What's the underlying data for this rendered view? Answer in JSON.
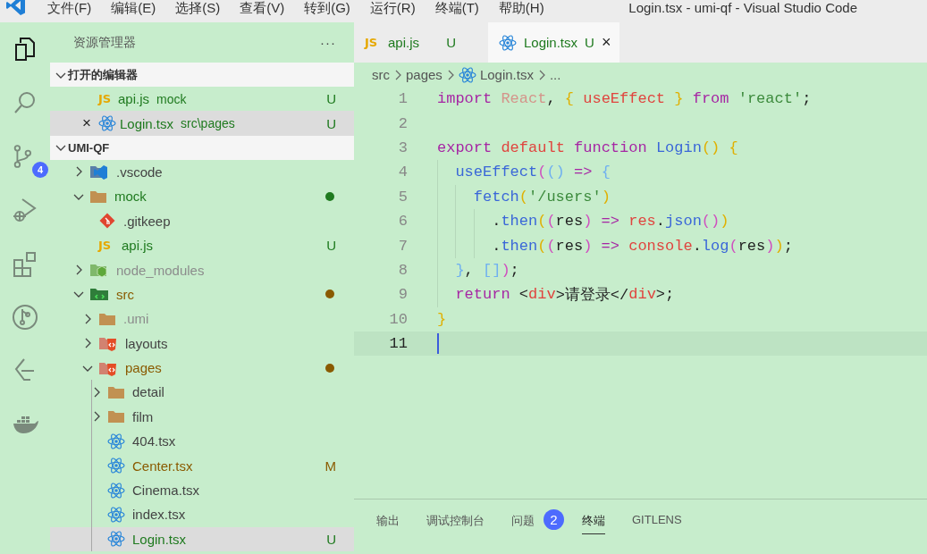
{
  "window": {
    "title": "Login.tsx - umi-qf - Visual Studio Code"
  },
  "menu": [
    {
      "label": "文件(F)"
    },
    {
      "label": "编辑(E)"
    },
    {
      "label": "选择(S)"
    },
    {
      "label": "查看(V)"
    },
    {
      "label": "转到(G)"
    },
    {
      "label": "运行(R)"
    },
    {
      "label": "终端(T)"
    },
    {
      "label": "帮助(H)"
    }
  ],
  "activity_bar": [
    {
      "kind": "explorer",
      "selected": true
    },
    {
      "kind": "search",
      "selected": false
    },
    {
      "kind": "scm",
      "selected": false,
      "badge": "4"
    },
    {
      "kind": "debug",
      "selected": false
    },
    {
      "kind": "extensions",
      "selected": false
    },
    {
      "kind": "git-graph",
      "selected": false
    },
    {
      "kind": "leetcode",
      "selected": false
    },
    {
      "kind": "docker",
      "selected": false
    }
  ],
  "sidebar": {
    "title": "资源管理器",
    "more": "···",
    "open_editors": {
      "title": "打开的编辑器",
      "expanded": true,
      "items": [
        {
          "name": "api.js",
          "description": "mock",
          "kind": "js",
          "icon_label": "JS",
          "status": "U",
          "color": "#1f7a1f",
          "selected": false
        },
        {
          "name": "Login.tsx",
          "description": "src\\pages",
          "kind": "react",
          "status": "U",
          "color": "#1f7a1f",
          "selected": true,
          "close": "×"
        }
      ]
    },
    "workspace": {
      "title": "UMI-QF",
      "expanded": true,
      "tree": [
        {
          "name": ".vscode",
          "kind": "vscode-folder",
          "expanded": false,
          "color": "#444444",
          "selected": false
        },
        {
          "name": "mock",
          "kind": "folder",
          "expanded": true,
          "color": "#1f7a1f",
          "changes": true,
          "selected": false,
          "children": [
            {
              "name": ".gitkeep",
              "kind": "git-file",
              "color": "#444444",
              "selected": false
            },
            {
              "name": "api.js",
              "kind": "js",
              "icon_label": "JS",
              "color": "#1f7a1f",
              "status": "U",
              "selected": false
            }
          ]
        },
        {
          "name": "node_modules",
          "kind": "node-folder",
          "expanded": false,
          "color": "#8c8c8c",
          "selected": false
        },
        {
          "name": "src",
          "kind": "src-folder",
          "expanded": true,
          "color": "#8a5a00",
          "changes": true,
          "selected": false,
          "children": [
            {
              "name": ".umi",
              "kind": "folder",
              "expanded": false,
              "color": "#8c8c8c",
              "selected": false
            },
            {
              "name": "layouts",
              "kind": "html-folder",
              "expanded": false,
              "color": "#444444",
              "selected": false
            },
            {
              "name": "pages",
              "kind": "html-folder",
              "expanded": true,
              "color": "#8a5a00",
              "changes": true,
              "selected": false,
              "children": [
                {
                  "name": "detail",
                  "kind": "folder",
                  "expanded": false,
                  "color": "#444444",
                  "selected": false
                },
                {
                  "name": "film",
                  "kind": "folder",
                  "expanded": false,
                  "color": "#444444",
                  "selected": false
                },
                {
                  "name": "404.tsx",
                  "kind": "react",
                  "color": "#444444",
                  "selected": false
                },
                {
                  "name": "Center.tsx",
                  "kind": "react",
                  "color": "#8a5a00",
                  "status": "M",
                  "selected": false
                },
                {
                  "name": "Cinema.tsx",
                  "kind": "react",
                  "color": "#444444",
                  "selected": false
                },
                {
                  "name": "index.tsx",
                  "kind": "react",
                  "color": "#444444",
                  "selected": false
                },
                {
                  "name": "Login.tsx",
                  "kind": "react",
                  "color": "#1f7a1f",
                  "status": "U",
                  "selected": true
                }
              ]
            }
          ]
        }
      ]
    }
  },
  "editor": {
    "tabs": [
      {
        "label": "api.js",
        "kind": "js",
        "icon_label": "JS",
        "status": "U",
        "selected": false
      },
      {
        "label": "Login.tsx",
        "kind": "react",
        "status": "U",
        "selected": true,
        "close": "×"
      }
    ],
    "breadcrumbs": [
      {
        "label": "src"
      },
      {
        "label": "pages"
      },
      {
        "label": "Login.tsx",
        "kind": "react"
      },
      {
        "label": "..."
      }
    ],
    "lines": [
      {
        "number": "1",
        "current": false,
        "tokens": [
          {
            "kind": "kw",
            "text": "import "
          },
          {
            "kind": "muted",
            "text": "React"
          },
          {
            "kind": "plain",
            "text": ", "
          },
          {
            "kind": "b1",
            "text": "{ "
          },
          {
            "kind": "red",
            "text": "useEffect "
          },
          {
            "kind": "b1",
            "text": "} "
          },
          {
            "kind": "kw",
            "text": "from "
          },
          {
            "kind": "str",
            "text": "'react'"
          },
          {
            "kind": "plain",
            "text": ";"
          }
        ]
      },
      {
        "number": "2",
        "current": false
      },
      {
        "number": "3",
        "current": false,
        "tokens": [
          {
            "kind": "kw",
            "text": "export "
          },
          {
            "kind": "red",
            "text": "default "
          },
          {
            "kind": "kw",
            "text": "function "
          },
          {
            "kind": "fn",
            "text": "Login"
          },
          {
            "kind": "b1",
            "text": "() {"
          }
        ]
      },
      {
        "number": "4",
        "current": false,
        "tokens": [
          {
            "kind": "fn",
            "text": "  useEffect"
          },
          {
            "kind": "b2",
            "text": "("
          },
          {
            "kind": "b3",
            "text": "() "
          },
          {
            "kind": "kw",
            "text": "=> "
          },
          {
            "kind": "b3",
            "text": "{"
          }
        ]
      },
      {
        "number": "5",
        "current": false,
        "tokens": [
          {
            "kind": "fn",
            "text": "    fetch"
          },
          {
            "kind": "b1",
            "text": "("
          },
          {
            "kind": "str",
            "text": "'/users'"
          },
          {
            "kind": "b1",
            "text": ")"
          }
        ]
      },
      {
        "number": "6",
        "current": false,
        "tokens": [
          {
            "kind": "plain",
            "text": "      ."
          },
          {
            "kind": "fn",
            "text": "then"
          },
          {
            "kind": "b1",
            "text": "("
          },
          {
            "kind": "b2",
            "text": "("
          },
          {
            "kind": "plain",
            "text": "res"
          },
          {
            "kind": "b2",
            "text": ") "
          },
          {
            "kind": "kw",
            "text": "=> "
          },
          {
            "kind": "red",
            "text": "res"
          },
          {
            "kind": "plain",
            "text": "."
          },
          {
            "kind": "fn",
            "text": "json"
          },
          {
            "kind": "b2",
            "text": "()"
          },
          {
            "kind": "b1",
            "text": ")"
          }
        ]
      },
      {
        "number": "7",
        "current": false,
        "tokens": [
          {
            "kind": "plain",
            "text": "      ."
          },
          {
            "kind": "fn",
            "text": "then"
          },
          {
            "kind": "b1",
            "text": "("
          },
          {
            "kind": "b2",
            "text": "("
          },
          {
            "kind": "plain",
            "text": "res"
          },
          {
            "kind": "b2",
            "text": ") "
          },
          {
            "kind": "kw",
            "text": "=> "
          },
          {
            "kind": "red",
            "text": "console"
          },
          {
            "kind": "plain",
            "text": "."
          },
          {
            "kind": "fn",
            "text": "log"
          },
          {
            "kind": "b2",
            "text": "("
          },
          {
            "kind": "plain",
            "text": "res"
          },
          {
            "kind": "b2",
            "text": ")"
          },
          {
            "kind": "b1",
            "text": ")"
          },
          {
            "kind": "plain",
            "text": ";"
          }
        ]
      },
      {
        "number": "8",
        "current": false,
        "tokens": [
          {
            "kind": "b3",
            "text": "  }"
          },
          {
            "kind": "plain",
            "text": ", "
          },
          {
            "kind": "b3",
            "text": "[]"
          },
          {
            "kind": "b2",
            "text": ")"
          },
          {
            "kind": "plain",
            "text": ";"
          }
        ]
      },
      {
        "number": "9",
        "current": false,
        "tokens": [
          {
            "kind": "kw",
            "text": "  return "
          },
          {
            "kind": "plain",
            "text": "<"
          },
          {
            "kind": "red",
            "text": "div"
          },
          {
            "kind": "plain",
            "text": ">请登录</"
          },
          {
            "kind": "red",
            "text": "div"
          },
          {
            "kind": "plain",
            "text": ">;"
          }
        ]
      },
      {
        "number": "10",
        "current": false,
        "tokens": [
          {
            "kind": "b1",
            "text": "}"
          }
        ]
      },
      {
        "number": "11",
        "current": true
      }
    ]
  },
  "panel": {
    "tabs": [
      {
        "label": "输出",
        "selected": false
      },
      {
        "label": "调试控制台",
        "selected": false
      },
      {
        "label": "问题",
        "selected": false,
        "badge": "2"
      },
      {
        "label": "终端",
        "selected": true
      },
      {
        "label": "GITLENS",
        "selected": false
      }
    ]
  }
}
